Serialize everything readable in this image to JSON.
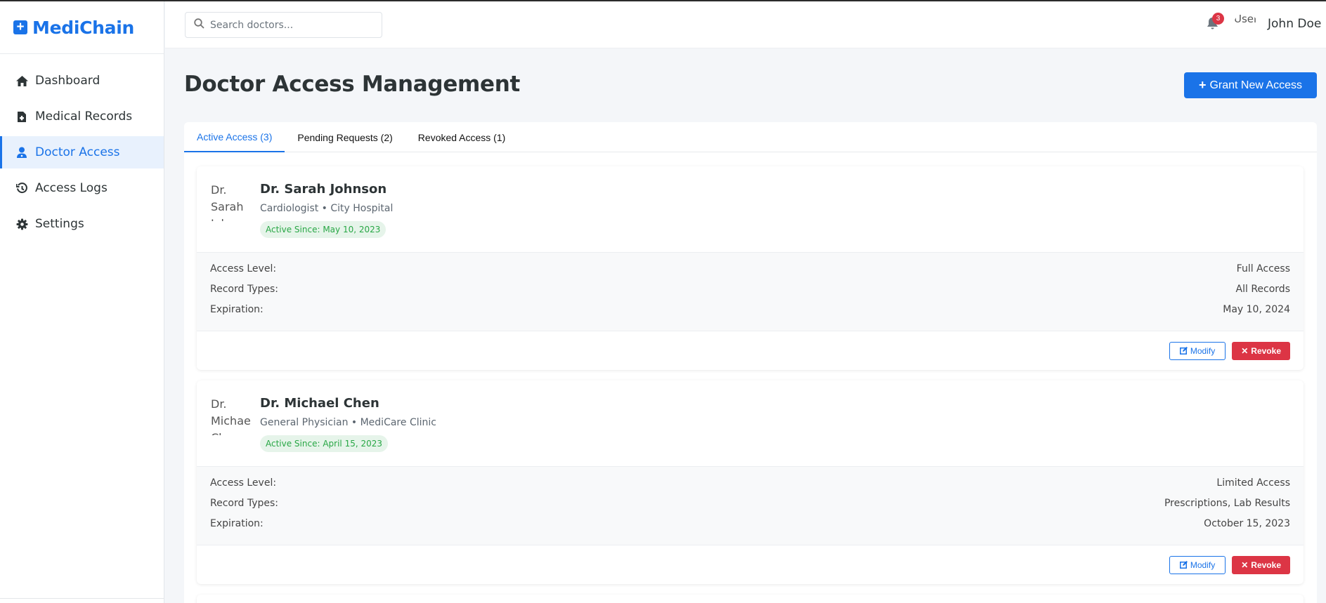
{
  "app": {
    "name": "MediChain"
  },
  "sidebar": {
    "items": [
      {
        "label": "Dashboard",
        "icon": "home-icon",
        "active": false
      },
      {
        "label": "Medical Records",
        "icon": "file-medical-icon",
        "active": false
      },
      {
        "label": "Doctor Access",
        "icon": "user-doctor-icon",
        "active": true
      },
      {
        "label": "Access Logs",
        "icon": "history-icon",
        "active": false
      },
      {
        "label": "Settings",
        "icon": "gear-icon",
        "active": false
      }
    ]
  },
  "header": {
    "search": {
      "placeholder": "Search doctors...",
      "value": ""
    },
    "notifications": {
      "count": "3"
    },
    "user": {
      "avatar_alt": "User",
      "name": "John Doe"
    }
  },
  "main": {
    "title": "Doctor Access Management",
    "grant_button": {
      "icon": "+",
      "label": "Grant New Access"
    },
    "tabs": [
      {
        "label": "Active Access (3)",
        "active": true
      },
      {
        "label": "Pending Requests (2)",
        "active": false
      },
      {
        "label": "Revoked Access (1)",
        "active": false
      }
    ],
    "doctors": [
      {
        "avatar_alt": "Dr. Sarah Johnson",
        "name": "Dr. Sarah Johnson",
        "specialty": "Cardiologist • City Hospital",
        "since": "Active Since: May 10, 2023",
        "details": [
          {
            "label": "Access Level:",
            "value": "Full Access"
          },
          {
            "label": "Record Types:",
            "value": "All Records"
          },
          {
            "label": "Expiration:",
            "value": "May 10, 2024"
          }
        ],
        "modify_label": "Modify",
        "revoke_label": "Revoke"
      },
      {
        "avatar_alt": "Dr. Michael Chen",
        "name": "Dr. Michael Chen",
        "specialty": "General Physician • MediCare Clinic",
        "since": "Active Since: April 15, 2023",
        "details": [
          {
            "label": "Access Level:",
            "value": "Limited Access"
          },
          {
            "label": "Record Types:",
            "value": "Prescriptions, Lab Results"
          },
          {
            "label": "Expiration:",
            "value": "October 15, 2023"
          }
        ],
        "modify_label": "Modify",
        "revoke_label": "Revoke"
      }
    ]
  },
  "colors": {
    "primary": "#1a73e8",
    "danger": "#dc3545",
    "success": "#28a745",
    "success_bg": "#e6f4ea",
    "active_nav_bg": "#e8f1fd"
  }
}
